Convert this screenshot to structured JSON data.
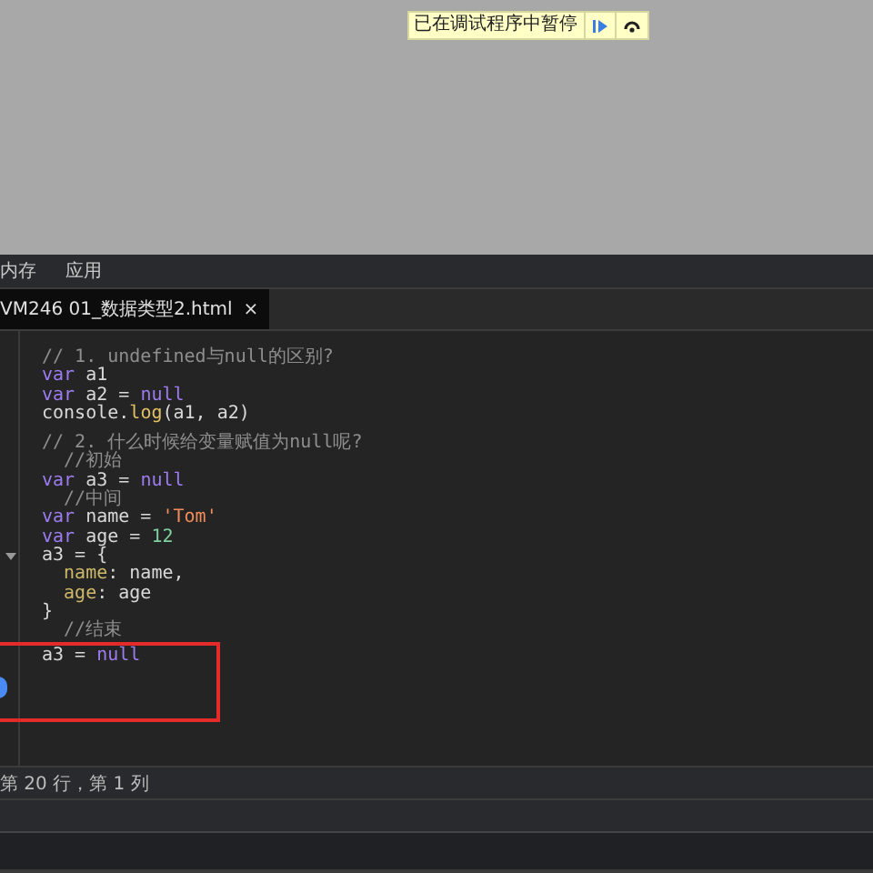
{
  "paused_banner": {
    "message": "已在调试程序中暂停"
  },
  "panel_tabs": [
    {
      "label": "内存",
      "selected": false
    },
    {
      "label": "应用",
      "selected": false
    }
  ],
  "file_tab": {
    "label": "VM246 01_数据类型2.html",
    "close": "×",
    "selected": true
  },
  "code_lines": [
    {
      "tokens": [
        {
          "kind": "comment",
          "text": "// 1. undefined与null的区别?"
        }
      ]
    },
    {
      "tokens": [
        {
          "kind": "keyword",
          "text": "var"
        },
        {
          "kind": "plain",
          "text": " a1"
        }
      ]
    },
    {
      "tokens": [
        {
          "kind": "keyword",
          "text": "var"
        },
        {
          "kind": "plain",
          "text": " a2 = "
        },
        {
          "kind": "keyword",
          "text": "null"
        }
      ]
    },
    {
      "tokens": [
        {
          "kind": "plain",
          "text": "console."
        },
        {
          "kind": "function",
          "text": "log"
        },
        {
          "kind": "plain",
          "text": "(a1, a2)"
        }
      ]
    },
    {
      "gap_before": true,
      "tokens": [
        {
          "kind": "comment",
          "text": "// 2. 什么时候给变量赋值为null呢?"
        }
      ]
    },
    {
      "tokens": [
        {
          "kind": "comment",
          "text": "  //初始"
        }
      ]
    },
    {
      "tokens": [
        {
          "kind": "keyword",
          "text": "var"
        },
        {
          "kind": "plain",
          "text": " a3 = "
        },
        {
          "kind": "keyword",
          "text": "null"
        }
      ]
    },
    {
      "tokens": [
        {
          "kind": "comment",
          "text": "  //中间"
        }
      ]
    },
    {
      "tokens": [
        {
          "kind": "keyword",
          "text": "var"
        },
        {
          "kind": "plain",
          "text": " name = "
        },
        {
          "kind": "string",
          "text": "'Tom'"
        }
      ]
    },
    {
      "tokens": [
        {
          "kind": "keyword",
          "text": "var"
        },
        {
          "kind": "plain",
          "text": " age = "
        },
        {
          "kind": "number",
          "text": "12"
        }
      ]
    },
    {
      "foldable": true,
      "tokens": [
        {
          "kind": "plain",
          "text": "a3 = {"
        }
      ]
    },
    {
      "indent": true,
      "tokens": [
        {
          "kind": "property",
          "text": "name"
        },
        {
          "kind": "plain",
          "text": ": name,"
        }
      ]
    },
    {
      "indent": true,
      "tokens": [
        {
          "kind": "property",
          "text": "age"
        },
        {
          "kind": "plain",
          "text": ": age"
        }
      ]
    },
    {
      "tokens": [
        {
          "kind": "plain",
          "text": "}"
        }
      ]
    },
    {
      "tokens": [
        {
          "kind": "comment",
          "text": "  //结束"
        }
      ]
    },
    {
      "tokens": [
        {
          "kind": "plain",
          "text": "a3 = "
        },
        {
          "kind": "keyword",
          "text": "null"
        }
      ]
    }
  ],
  "status_bar": {
    "position": "第 20 行，第 1 列"
  }
}
